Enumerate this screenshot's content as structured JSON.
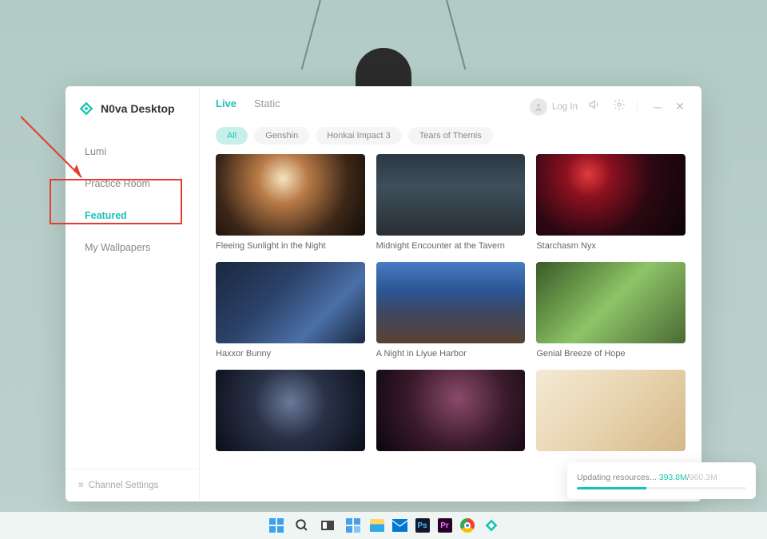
{
  "app": {
    "title": "N0va Desktop"
  },
  "topbar": {
    "login": "Log In",
    "tabs": [
      {
        "label": "Live",
        "active": true
      },
      {
        "label": "Static",
        "active": false
      }
    ]
  },
  "sidebar": {
    "items": [
      {
        "label": "Lumi",
        "active": false
      },
      {
        "label": "Practice Room",
        "active": false
      },
      {
        "label": "Featured",
        "active": true
      },
      {
        "label": "My Wallpapers",
        "active": false
      }
    ],
    "footer": "Channel Settings"
  },
  "filters": [
    {
      "label": "All",
      "active": true
    },
    {
      "label": "Genshin",
      "active": false
    },
    {
      "label": "Honkai Impact 3",
      "active": false
    },
    {
      "label": "Tears of Themis",
      "active": false
    }
  ],
  "wallpapers": [
    {
      "title": "Fleeing Sunlight in the Night",
      "thumb_class": "t-night1"
    },
    {
      "title": "Midnight Encounter at the Tavern",
      "thumb_class": "t-tavern"
    },
    {
      "title": "Starchasm Nyx",
      "thumb_class": "t-starchasm"
    },
    {
      "title": "Haxxor Bunny",
      "thumb_class": "t-haxxor"
    },
    {
      "title": "A Night in Liyue Harbor",
      "thumb_class": "t-liyue"
    },
    {
      "title": "Genial Breeze of Hope",
      "thumb_class": "t-genial"
    },
    {
      "title": "",
      "thumb_class": "t-dark1"
    },
    {
      "title": "",
      "thumb_class": "t-dark2"
    },
    {
      "title": "",
      "thumb_class": "t-light"
    }
  ],
  "toast": {
    "label": "Updating resources...",
    "current": "393.8M",
    "total": "960.3M",
    "progress_percent": 41
  },
  "taskbar": {
    "ps": "Ps",
    "pr": "Pr"
  }
}
